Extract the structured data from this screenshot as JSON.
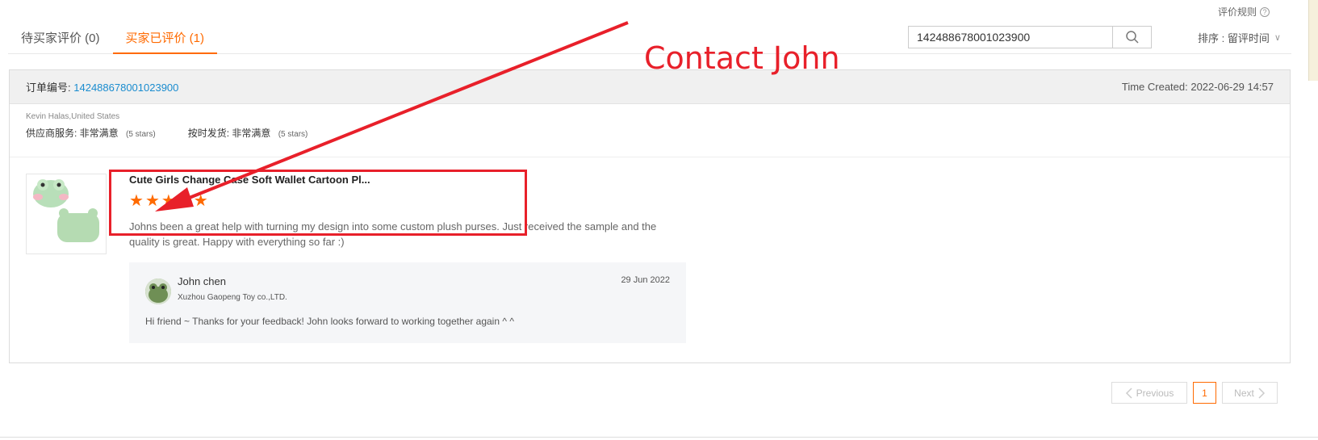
{
  "header": {
    "rules_label": "评价规则",
    "help_glyph": "?",
    "tabs": [
      {
        "label": "待买家评价 (0)",
        "active": false
      },
      {
        "label": "买家已评价 (1)",
        "active": true
      }
    ],
    "search": {
      "value": "142488678001023900",
      "icon": "search-icon"
    },
    "sort_label": "排序 : 留评时间",
    "sort_chevron": "∨"
  },
  "order": {
    "number_label": "订单编号:",
    "number": "142488678001023900",
    "time_created": "Time Created: 2022-06-29 14:57"
  },
  "buyer": {
    "name": "Kevin Halas,United States",
    "ratings": [
      {
        "label": "供应商服务: 非常满意",
        "note": "(5 stars)"
      },
      {
        "label": "按时发货: 非常满意",
        "note": "(5 stars)"
      }
    ]
  },
  "product": {
    "title": "Cute Girls Change Case Soft Wallet Cartoon Pl...",
    "rating": 5,
    "star_glyph": "★",
    "comment": "Johns been a great help with turning my design into some custom plush purses. Just received the sample and the quality is great. Happy with everything so far :)"
  },
  "reply": {
    "name": "John chen",
    "company": "Xuzhou Gaopeng Toy co.,LTD.",
    "date": "29 Jun 2022",
    "text": "Hi friend ~ Thanks for your feedback! John looks forward to working together again ^ ^"
  },
  "pagination": {
    "prev_label": "Previous",
    "current": "1",
    "next_label": "Next"
  },
  "annotation": {
    "text": "Contact John",
    "color": "#e8202a"
  },
  "colors": {
    "accent": "#ff6a00",
    "link": "#1a8ccf"
  }
}
